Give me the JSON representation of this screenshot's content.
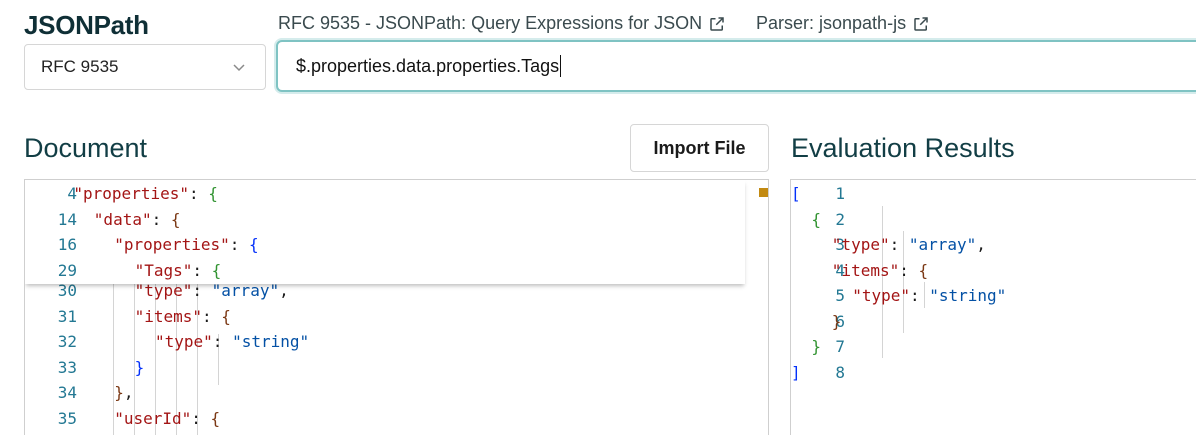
{
  "app": {
    "title": "JSONPath"
  },
  "links": [
    {
      "label": "RFC 9535 - JSONPath: Query Expressions for JSON"
    },
    {
      "label": "Parser: jsonpath-js"
    }
  ],
  "spec_select": {
    "value": "RFC 9535"
  },
  "query": {
    "value": "$.properties.data.properties.Tags"
  },
  "document": {
    "title": "Document",
    "import_label": "Import File",
    "sticky_lines": [
      {
        "num": "4",
        "key": "\"properties\"",
        "brace": "{",
        "level": 2
      },
      {
        "num": "14",
        "key": "\"data\"",
        "brace": "{",
        "level": 3
      },
      {
        "num": "16",
        "key": "\"properties\"",
        "brace": "{",
        "level": 1
      },
      {
        "num": "29",
        "key": "\"Tags\"",
        "brace": "{",
        "level": 2
      }
    ],
    "lines": [
      {
        "num": "30",
        "key": "\"type\"",
        "value": "\"array\"",
        "tail": ","
      },
      {
        "num": "31",
        "key": "\"items\"",
        "brace": "{"
      },
      {
        "num": "32",
        "key": "\"type\"",
        "value": "\"string\"",
        "tail": ""
      },
      {
        "num": "33",
        "close": "}"
      },
      {
        "num": "34",
        "close": "}",
        "tail": ","
      },
      {
        "num": "35",
        "key": "\"userId\"",
        "brace": "{"
      }
    ]
  },
  "results": {
    "title": "Evaluation Results",
    "lines": [
      {
        "num": "1",
        "text": "["
      },
      {
        "num": "2",
        "text": "{"
      },
      {
        "num": "3",
        "key": "\"type\"",
        "value": "\"array\"",
        "tail": ","
      },
      {
        "num": "4",
        "key": "\"items\"",
        "brace": "{"
      },
      {
        "num": "5",
        "key": "\"type\"",
        "value": "\"string\""
      },
      {
        "num": "6",
        "text": "}"
      },
      {
        "num": "7",
        "text": "}"
      },
      {
        "num": "8",
        "text": "]"
      }
    ]
  },
  "colors": {
    "accent": "#7fc3c3",
    "title": "#123e45",
    "line_number": "#237893"
  }
}
